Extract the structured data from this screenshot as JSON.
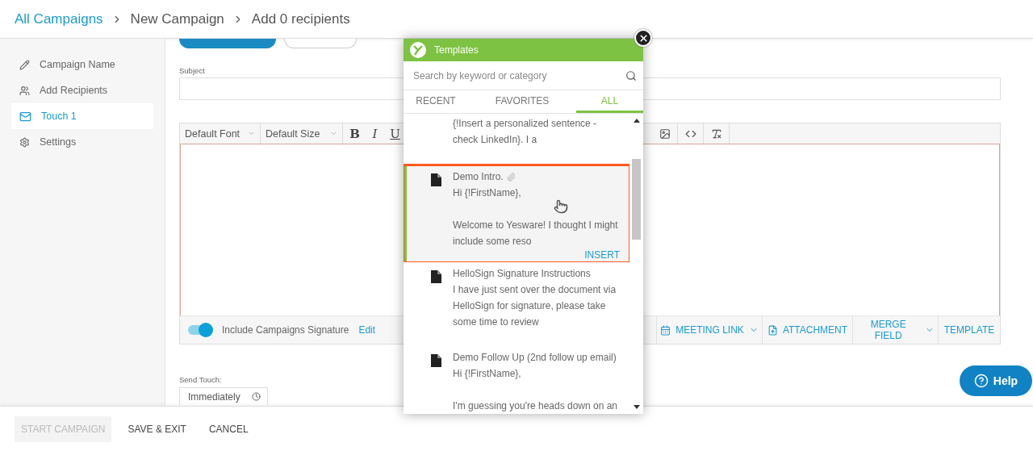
{
  "breadcrumb": [
    {
      "label": "All Campaigns",
      "kind": "link"
    },
    {
      "label": "New Campaign",
      "kind": "step"
    },
    {
      "label": "Add 0 recipients",
      "kind": "step"
    }
  ],
  "sidebar": {
    "items": [
      {
        "label": "Campaign Name",
        "kind": "name",
        "selected": false
      },
      {
        "label": "Add Recipients",
        "kind": "recipients",
        "selected": false
      },
      {
        "label": "Touch 1",
        "kind": "touch",
        "selected": true
      },
      {
        "label": "Settings",
        "kind": "settings",
        "selected": false
      }
    ]
  },
  "subject": {
    "label": "Subject"
  },
  "editor": {
    "font": "Default Font",
    "size": "Default Size",
    "format": [
      "B",
      "I",
      "U"
    ],
    "signature": {
      "on": true,
      "label": "Include Campaigns Signature",
      "edit": "Edit"
    },
    "actions": [
      {
        "label": "MEETING LINK",
        "kind": "meeting",
        "dropdown": true
      },
      {
        "label": "ATTACHMENT",
        "kind": "attachment",
        "dropdown": false
      },
      {
        "label": "MERGE FIELD",
        "kind": "merge",
        "dropdown": true
      },
      {
        "label": "TEMPLATE",
        "kind": "template",
        "dropdown": false
      }
    ]
  },
  "send_touch": {
    "label": "Send Touch:",
    "value": "Immediately"
  },
  "footer": [
    {
      "label": "START CAMPAIGN",
      "disabled": true
    },
    {
      "label": "SAVE & EXIT",
      "disabled": false
    },
    {
      "label": "CANCEL",
      "disabled": false
    }
  ],
  "help": "Help",
  "templates": {
    "title": "Templates",
    "search": {
      "placeholder": "Search by keyword or category"
    },
    "tabs": [
      {
        "label": "RECENT",
        "selected": false
      },
      {
        "label": "FAVORITES",
        "selected": false
      },
      {
        "label": "ALL",
        "selected": true
      }
    ],
    "items": [
      {
        "body": [
          "{!Insert a personalized sentence - check LinkedIn}. I a"
        ],
        "hovered": false,
        "highlighted": false
      },
      {
        "title": "Demo Intro.",
        "attachment": true,
        "body": [
          "Hi {!FirstName},",
          "Welcome to Yesware! I thought I might include some reso"
        ],
        "hovered": true,
        "highlighted": true,
        "insert": "INSERT"
      },
      {
        "title": "HelloSign Signature Instructions",
        "attachment": false,
        "body": [
          "I have just sent over the document via HelloSign for signature, please take some time to review"
        ],
        "hovered": false,
        "highlighted": false
      },
      {
        "title": "Demo Follow Up (2nd follow up email)",
        "attachment": false,
        "body": [
          "Hi {!FirstName},",
          "I'm guessing you're heads down on an"
        ],
        "hovered": false,
        "highlighted": false
      }
    ]
  }
}
